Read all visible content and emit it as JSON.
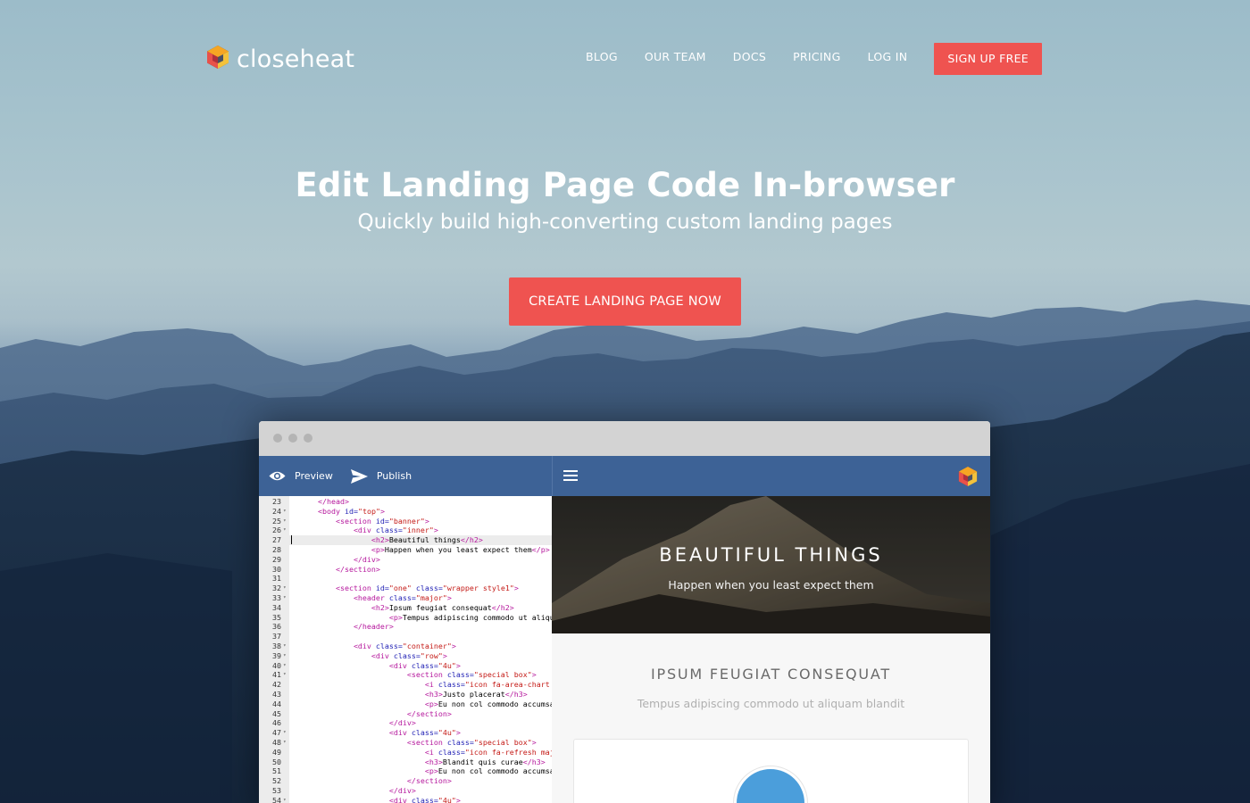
{
  "brand": {
    "name": "closeheat"
  },
  "nav": {
    "items": [
      {
        "label": "BLOG"
      },
      {
        "label": "OUR TEAM"
      },
      {
        "label": "DOCS"
      },
      {
        "label": "PRICING"
      },
      {
        "label": "LOG IN"
      }
    ],
    "cta_label": "SIGN UP FREE"
  },
  "hero": {
    "title": "Edit Landing Page Code In-browser",
    "subtitle": "Quickly build high-converting custom landing pages",
    "cta_label": "CREATE LANDING PAGE NOW"
  },
  "editor": {
    "toolbar": {
      "preview_label": "Preview",
      "publish_label": "Publish"
    },
    "active_line": 27,
    "lines": [
      {
        "n": "23",
        "fold": false,
        "html": "      <span class='tag'>&lt;/head&gt;</span>"
      },
      {
        "n": "24",
        "fold": true,
        "html": "      <span class='tag'>&lt;body</span> <span class='attr'>id=</span><span class='str'>\"top\"</span><span class='tag'>&gt;</span>"
      },
      {
        "n": "25",
        "fold": true,
        "html": "          <span class='tag'>&lt;section</span> <span class='attr'>id=</span><span class='str'>\"banner\"</span><span class='tag'>&gt;</span>"
      },
      {
        "n": "26",
        "fold": true,
        "html": "              <span class='tag'>&lt;div</span> <span class='attr'>class=</span><span class='str'>\"inner\"</span><span class='tag'>&gt;</span>"
      },
      {
        "n": "27",
        "fold": false,
        "html": "                  <span class='tag'>&lt;h2&gt;</span>Beautiful things<span class='tag'>&lt;/h2&gt;</span>"
      },
      {
        "n": "28",
        "fold": false,
        "html": "                  <span class='tag'>&lt;p&gt;</span>Happen when you least expect them<span class='tag'>&lt;/p&gt;</span>"
      },
      {
        "n": "29",
        "fold": false,
        "html": "              <span class='tag'>&lt;/div&gt;</span>"
      },
      {
        "n": "30",
        "fold": false,
        "html": "          <span class='tag'>&lt;/section&gt;</span>"
      },
      {
        "n": "31",
        "fold": false,
        "html": ""
      },
      {
        "n": "32",
        "fold": true,
        "html": "          <span class='tag'>&lt;section</span> <span class='attr'>id=</span><span class='str'>\"one\"</span> <span class='attr'>class=</span><span class='str'>\"wrapper style1\"</span><span class='tag'>&gt;</span>"
      },
      {
        "n": "33",
        "fold": true,
        "html": "              <span class='tag'>&lt;header</span> <span class='attr'>class=</span><span class='str'>\"major\"</span><span class='tag'>&gt;</span>"
      },
      {
        "n": "34",
        "fold": false,
        "html": "                  <span class='tag'>&lt;h2&gt;</span>Ipsum feugiat consequat<span class='tag'>&lt;/h2&gt;</span>"
      },
      {
        "n": "35",
        "fold": false,
        "html": "                      <span class='tag'>&lt;p&gt;</span>Tempus adipiscing commodo ut aliquam blandit"
      },
      {
        "n": "36",
        "fold": false,
        "html": "              <span class='tag'>&lt;/header&gt;</span>"
      },
      {
        "n": "37",
        "fold": false,
        "html": ""
      },
      {
        "n": "38",
        "fold": true,
        "html": "              <span class='tag'>&lt;div</span> <span class='attr'>class=</span><span class='str'>\"container\"</span><span class='tag'>&gt;</span>"
      },
      {
        "n": "39",
        "fold": true,
        "html": "                  <span class='tag'>&lt;div</span> <span class='attr'>class=</span><span class='str'>\"row\"</span><span class='tag'>&gt;</span>"
      },
      {
        "n": "40",
        "fold": true,
        "html": "                      <span class='tag'>&lt;div</span> <span class='attr'>class=</span><span class='str'>\"4u\"</span><span class='tag'>&gt;</span>"
      },
      {
        "n": "41",
        "fold": true,
        "html": "                          <span class='tag'>&lt;section</span> <span class='attr'>class=</span><span class='str'>\"special box\"</span><span class='tag'>&gt;</span>"
      },
      {
        "n": "42",
        "fold": false,
        "html": "                              <span class='tag'>&lt;i</span> <span class='attr'>class=</span><span class='str'>\"icon fa-area-chart major\"</span>"
      },
      {
        "n": "43",
        "fold": false,
        "html": "                              <span class='tag'>&lt;h3&gt;</span>Justo placerat<span class='tag'>&lt;/h3&gt;</span>"
      },
      {
        "n": "44",
        "fold": false,
        "html": "                              <span class='tag'>&lt;p&gt;</span>Eu non col commodo accumsan"
      },
      {
        "n": "45",
        "fold": false,
        "html": "                          <span class='tag'>&lt;/section&gt;</span>"
      },
      {
        "n": "46",
        "fold": false,
        "html": "                      <span class='tag'>&lt;/div&gt;</span>"
      },
      {
        "n": "47",
        "fold": true,
        "html": "                      <span class='tag'>&lt;div</span> <span class='attr'>class=</span><span class='str'>\"4u\"</span><span class='tag'>&gt;</span>"
      },
      {
        "n": "48",
        "fold": true,
        "html": "                          <span class='tag'>&lt;section</span> <span class='attr'>class=</span><span class='str'>\"special box\"</span><span class='tag'>&gt;</span>"
      },
      {
        "n": "49",
        "fold": false,
        "html": "                              <span class='tag'>&lt;i</span> <span class='attr'>class=</span><span class='str'>\"icon fa-refresh major\"</span>"
      },
      {
        "n": "50",
        "fold": false,
        "html": "                              <span class='tag'>&lt;h3&gt;</span>Blandit quis curae<span class='tag'>&lt;/h3&gt;</span>"
      },
      {
        "n": "51",
        "fold": false,
        "html": "                              <span class='tag'>&lt;p&gt;</span>Eu non col commodo accumsan"
      },
      {
        "n": "52",
        "fold": false,
        "html": "                          <span class='tag'>&lt;/section&gt;</span>"
      },
      {
        "n": "53",
        "fold": false,
        "html": "                      <span class='tag'>&lt;/div&gt;</span>"
      },
      {
        "n": "54",
        "fold": true,
        "html": "                      <span class='tag'>&lt;div</span> <span class='attr'>class=</span><span class='str'>\"4u\"</span><span class='tag'>&gt;</span>"
      }
    ]
  },
  "preview": {
    "banner_title": "BEAUTIFUL THINGS",
    "banner_subtitle": "Happen when you least expect them",
    "section_title": "IPSUM FEUGIAT CONSEQUAT",
    "section_text": "Tempus adipiscing commodo ut aliquam blandit"
  },
  "colors": {
    "accent": "#ef5350",
    "toolbar": "#3d6296",
    "tag": "#b5169c",
    "attr": "#1f1fb4",
    "string": "#c41a16",
    "preview_circle": "#4b9edb"
  },
  "icons": {
    "logo": "hexagon-cube-icon",
    "preview": "eye-icon",
    "publish": "paper-plane-icon",
    "menu": "hamburger-menu-icon"
  }
}
